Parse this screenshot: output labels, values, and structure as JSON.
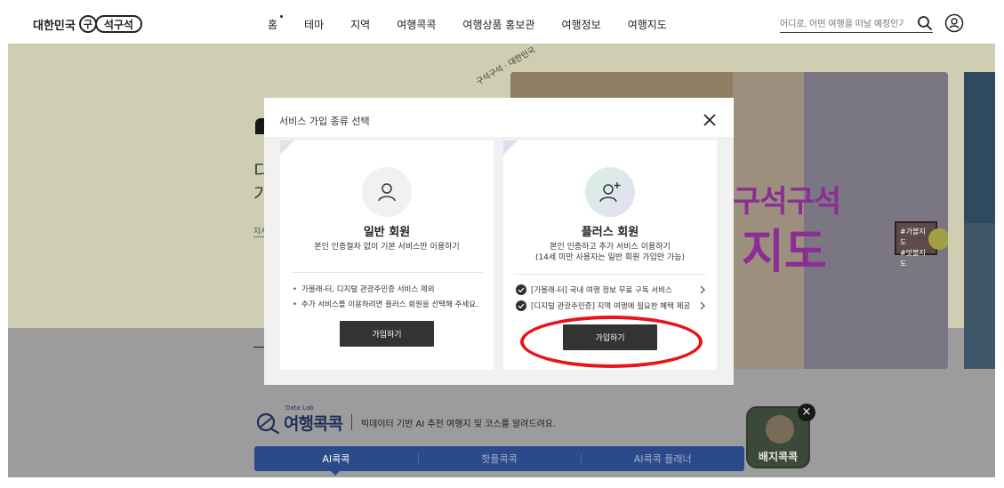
{
  "header": {
    "logo_text": "대한민국",
    "logo_circle": "구",
    "logo_pill": "석구석",
    "nav": [
      {
        "label": "홈",
        "active": true
      },
      {
        "label": "테마",
        "active": false
      },
      {
        "label": "지역",
        "active": false
      },
      {
        "label": "여행콕콕",
        "active": false
      },
      {
        "label": "여행상품 홍보관",
        "active": false
      },
      {
        "label": "여행정보",
        "active": false
      },
      {
        "label": "여행지도",
        "active": false
      }
    ],
    "search_placeholder": "어디로, 어떤 여행을 떠날 예정인가요?"
  },
  "hero": {
    "big_text": "디\n가",
    "small_text": "자서",
    "stamp_text": "구석구석 · 대한민국"
  },
  "banner": {
    "title_line1": "구석구석",
    "title_line2": "지도",
    "tag_text": "#가볼지도\n#맛볼지도"
  },
  "datalab": {
    "label": "Data Lab",
    "title": "여행콕콕",
    "description": "빅데이터 기반 AI 추천 여행지 및 코스를 알려드려요."
  },
  "tabs": [
    {
      "label": "AI콕콕",
      "active": true
    },
    {
      "label": "핫플콕콕",
      "active": false
    },
    {
      "label": "AI콕콕 플래너",
      "active": false
    }
  ],
  "badge_widget": {
    "label": "배지콕콕",
    "close_symbol": "×"
  },
  "modal": {
    "title": "서비스 가입 종류 선택",
    "general": {
      "name": "일반 회원",
      "description": "본인 인증절차 없이 기본 서비스만 이용하기",
      "notes": [
        "가볼래-터, 디지털 관광주민증 서비스 제외",
        "추가 서비스를 이용하려면 플러스 회원을 선택해 주세요."
      ],
      "button": "가입하기"
    },
    "plus": {
      "name": "플러스 회원",
      "description_line1": "본인 인증하고 추가 서비스 이용하기",
      "description_line2": "(14세 미만 사용자는 일반 회원 가입만 가능)",
      "benefits": [
        "[가볼래-터] 국내 여행 정보 무료 구독 서비스",
        "[디지털 관광주민증] 지역 여행에 필요한 혜택 제공"
      ],
      "button": "가입하기"
    }
  },
  "colors": {
    "overlay_hero": "#cfceb2",
    "overlay_lower": "#9d9c9c",
    "button_dark": "#333333",
    "highlight_ring": "#e8141b",
    "tab_bar": "#2b4a8a"
  }
}
